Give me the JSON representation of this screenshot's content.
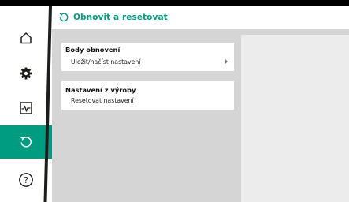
{
  "header": {
    "title": "Obnovit a resetovat",
    "icon": "restore-icon"
  },
  "sidebar": {
    "items": [
      {
        "name": "home",
        "icon": "home-icon",
        "active": false
      },
      {
        "name": "settings",
        "icon": "gear-icon",
        "active": false
      },
      {
        "name": "diagnostics",
        "icon": "pulse-icon",
        "active": false
      },
      {
        "name": "restore",
        "icon": "restore-icon",
        "active": true
      },
      {
        "name": "help",
        "icon": "help-icon",
        "active": false
      }
    ]
  },
  "main": {
    "sections": [
      {
        "heading": "Body obnovení",
        "item_label": "Uložit/načíst nastavení",
        "has_chevron": true
      },
      {
        "heading": "Nastavení z výroby",
        "item_label": "Resetovat nastavení",
        "has_chevron": false
      }
    ]
  },
  "colors": {
    "accent": "#009c82",
    "background": "#d5d5d5",
    "panel": "#ececec"
  }
}
